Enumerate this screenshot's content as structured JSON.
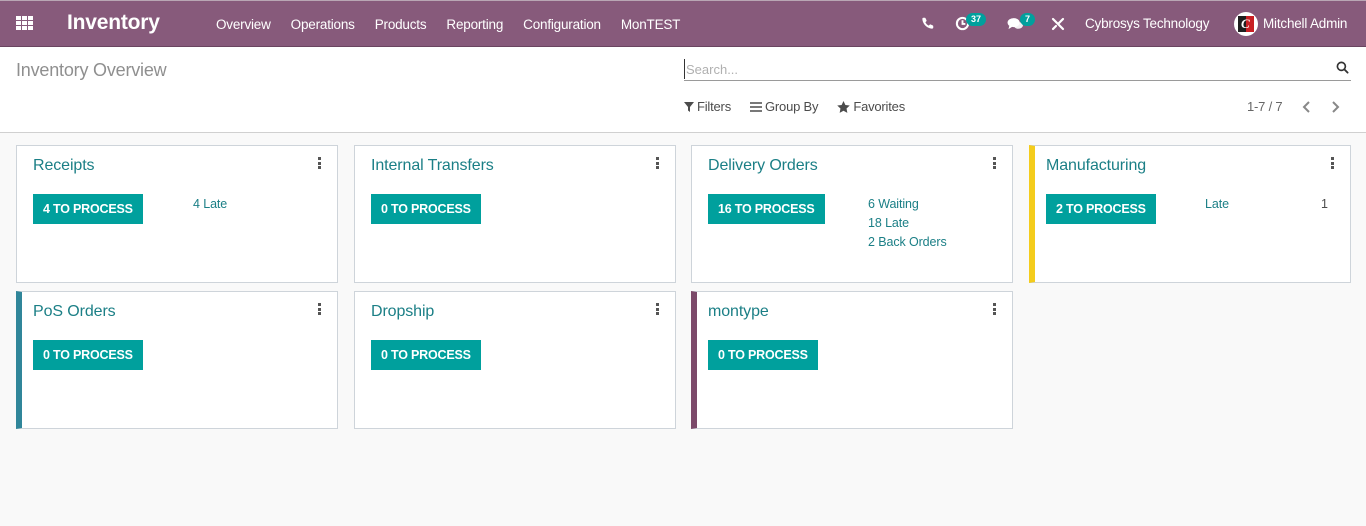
{
  "navbar": {
    "app_title": "Inventory",
    "menu": [
      "Overview",
      "Operations",
      "Products",
      "Reporting",
      "Configuration",
      "MonTEST"
    ],
    "activity_count": "37",
    "message_count": "7",
    "company": "Cybrosys Technology",
    "user": "Mitchell Admin"
  },
  "control_panel": {
    "breadcrumb": "Inventory Overview",
    "search_placeholder": "Search...",
    "filters_label": "Filters",
    "group_by_label": "Group By",
    "favorites_label": "Favorites",
    "pager": "1-7 / 7"
  },
  "colors": {
    "brand": "#875a7b",
    "accent": "#00a09d",
    "link": "#1b7f86"
  },
  "cards": [
    {
      "title": "Receipts",
      "button": "4 TO PROCESS",
      "color": null,
      "stats": [
        {
          "label": "4 Late"
        }
      ]
    },
    {
      "title": "Internal Transfers",
      "button": "0 TO PROCESS",
      "color": null,
      "stats": []
    },
    {
      "title": "Delivery Orders",
      "button": "16 TO PROCESS",
      "color": null,
      "stats": [
        {
          "label": "6 Waiting"
        },
        {
          "label": "18 Late"
        },
        {
          "label": "2 Back Orders"
        }
      ]
    },
    {
      "title": "Manufacturing",
      "button": "2 TO PROCESS",
      "color": "#f4cc1c",
      "stats": [
        {
          "label": "Late",
          "value": "1"
        }
      ]
    },
    {
      "title": "PoS Orders",
      "button": "0 TO PROCESS",
      "color": "#30869a",
      "stats": []
    },
    {
      "title": "Dropship",
      "button": "0 TO PROCESS",
      "color": null,
      "stats": []
    },
    {
      "title": "montype",
      "button": "0 TO PROCESS",
      "color": "#7c4a6a",
      "stats": []
    }
  ]
}
